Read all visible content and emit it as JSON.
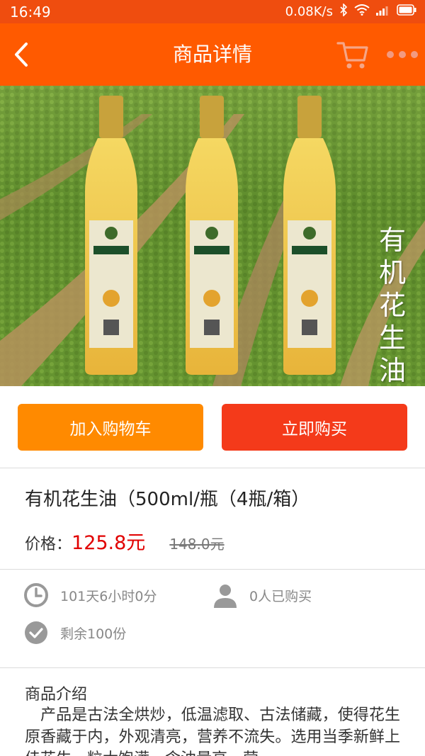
{
  "status_bar": {
    "time": "16:49",
    "network_speed": "0.08K/s",
    "icons": [
      "bluetooth-icon",
      "wifi-icon",
      "signal-icon",
      "battery-icon"
    ]
  },
  "header": {
    "title": "商品详情",
    "back_icon": "chevron-left-icon",
    "cart_icon": "shopping-cart-icon",
    "more_icon": "more-dots-icon"
  },
  "hero": {
    "vertical_caption": "有机花生油"
  },
  "actions": {
    "add_to_cart": "加入购物车",
    "buy_now": "立即购买"
  },
  "product": {
    "name": "有机花生油（500ml/瓶（4瓶/箱）",
    "price_label": "价格：",
    "price": "125.8元",
    "original_price": "148.0元"
  },
  "stats": {
    "time_left": "101天6小时0分",
    "buyers": "0人已购买",
    "remaining": "剩余100份"
  },
  "description": {
    "title": "商品介绍",
    "body": "产品是古法全烘炒，低温滤取、古法储藏，使得花生原香藏于内，外观清亮，营养不流失。选用当季新鲜上佳花生，粒大饱满，含油量高，营"
  },
  "colors": {
    "status_bar": "#ef4d0f",
    "header": "#ff5a00",
    "add_to_cart": "#ff8a00",
    "buy_now": "#f43a1a",
    "price": "#e10000"
  }
}
